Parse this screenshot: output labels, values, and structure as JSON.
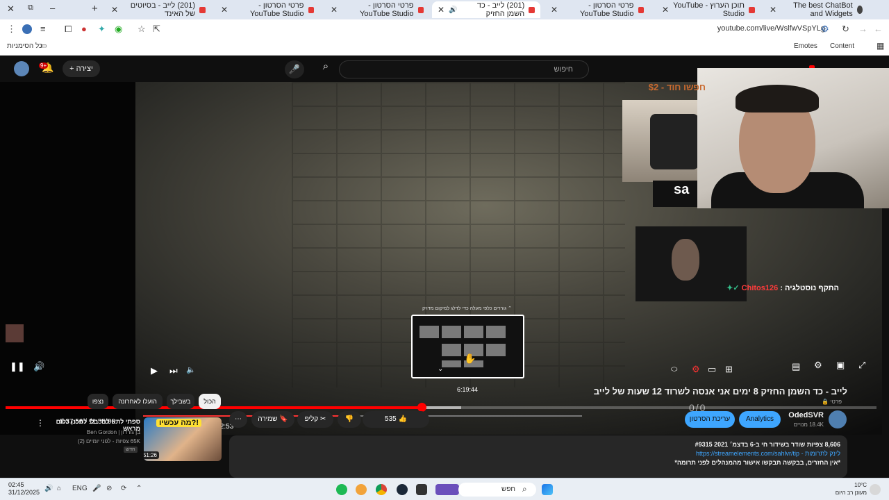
{
  "browser": {
    "tabs": [
      {
        "label": "The best ChatBot and Widgets",
        "active": false
      },
      {
        "label": "תוכן הערוץ - YouTube Studio",
        "active": false
      },
      {
        "label": "פרטי הסרטון - YouTube Studio",
        "active": false
      },
      {
        "label": "(201) לייב - כד השמן החזיק",
        "active": true
      },
      {
        "label": "פרטי הסרטון - YouTube Studio",
        "active": false
      },
      {
        "label": "פרטי הסרטון - YouTube Studio",
        "active": false
      },
      {
        "label": "(201) לייב - בסיוטים של האינד",
        "active": false
      }
    ],
    "url": "youtube.com/live/WslfwVSpYLg",
    "bookmarks": {
      "all": "כל הסימניות",
      "content": "Content",
      "emotes": "Emotes"
    }
  },
  "youtube": {
    "search_placeholder": "חיפוש",
    "create_label": "יצירה",
    "notif_badge": "9+"
  },
  "stream_overlay": {
    "tip_line": "חפשו חוד - $2",
    "chat_prefix": "התקף נוסטלגיה :",
    "chat_nick": "Chitos126",
    "logo_text": "sa",
    "score": "0/0"
  },
  "player": {
    "preview_label": "⌃ גוררים כלפי מעלה כדי לדלג למיקום מדויק",
    "preview_time": "6:19:44",
    "main_time": "5:37:56 / 11:55:00",
    "sub_time": "1:21 / 2:53",
    "progress": 0.478,
    "sub_progress": 0.47
  },
  "video": {
    "title": "לייב - כד השמן החזיק 8 ימים אני אנסה לשרוד 12 שעות של לייב",
    "privacy": "פרטי",
    "channel": "OdedSVR",
    "subs": "18.4K מנויים",
    "analytics": "Analytics",
    "edit": "עריכת הסרטון",
    "likes": "535",
    "clip": "קליפ",
    "save": "שמירה"
  },
  "description": {
    "line1": "8,606 צפיות  שודר בשידור חי ב-6 בדצמ׳ 2021  #9315",
    "line2": "לינק לתרומות - https://streamelements.com/sahlvr/tip",
    "line3": "*אין החזרים, בבקשה תבקשו אישור מהמנהלים לפני תרומה*"
  },
  "chips": [
    "הכול",
    "בשבילך",
    "הועלו לאחרונה",
    "נצפו"
  ],
  "recommendation": {
    "thumb_caption": "מה עכשיו?!",
    "duration": "51:26",
    "title": "ספתי לתאילנד בלי לתכנן כלום מראש",
    "channel": "בן גורדון | Ben Gordon",
    "meta": "65K צפיות - לפני יומיים (2)",
    "badge": "חדש"
  },
  "taskbar": {
    "time": "02:45",
    "date": "31/12/2025",
    "lang": "ENG",
    "search": "חפש",
    "temp": "10°C",
    "weather": "מעונן רב היום"
  },
  "colors": {
    "accent": "#ff0000",
    "blue_button": "#3ea6ff",
    "tip": "#c96a2f"
  }
}
